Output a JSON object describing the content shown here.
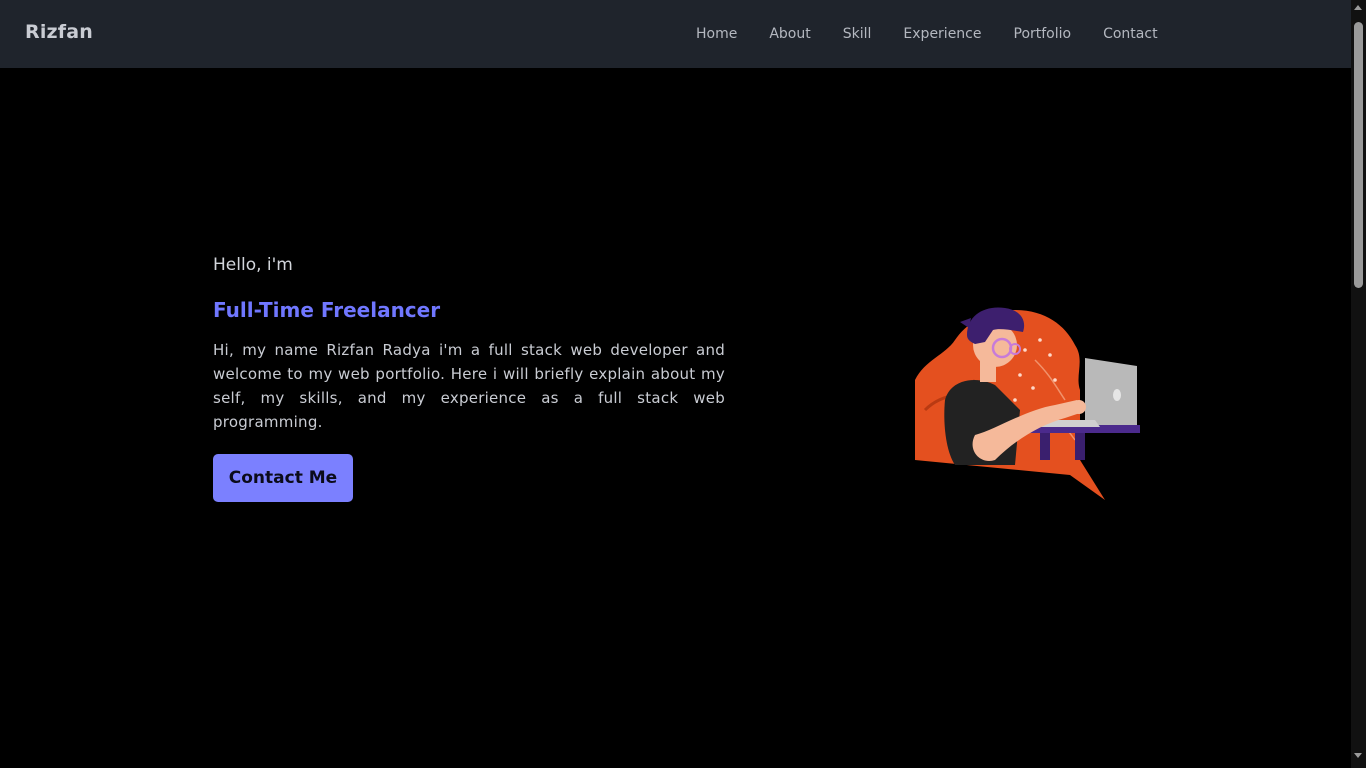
{
  "brand": "Rizfan",
  "nav": {
    "items": [
      {
        "label": "Home"
      },
      {
        "label": "About"
      },
      {
        "label": "Skill"
      },
      {
        "label": "Experience"
      },
      {
        "label": "Portfolio"
      },
      {
        "label": "Contact"
      }
    ]
  },
  "hero": {
    "greeting": "Hello, i'm",
    "role": "Full-Time Freelancer",
    "intro": "Hi, my name Rizfan Radya i'm a full stack web developer and welcome to my web portfolio. Here i will briefly explain about my self, my skills, and my experience as a full stack web programming.",
    "cta_label": "Contact Me",
    "illustration_icon": "developer-at-laptop-illustration"
  },
  "colors": {
    "navbar_bg": "#1f242c",
    "page_bg": "#000000",
    "accent": "#7077ff",
    "button_bg": "#7b80ff"
  }
}
